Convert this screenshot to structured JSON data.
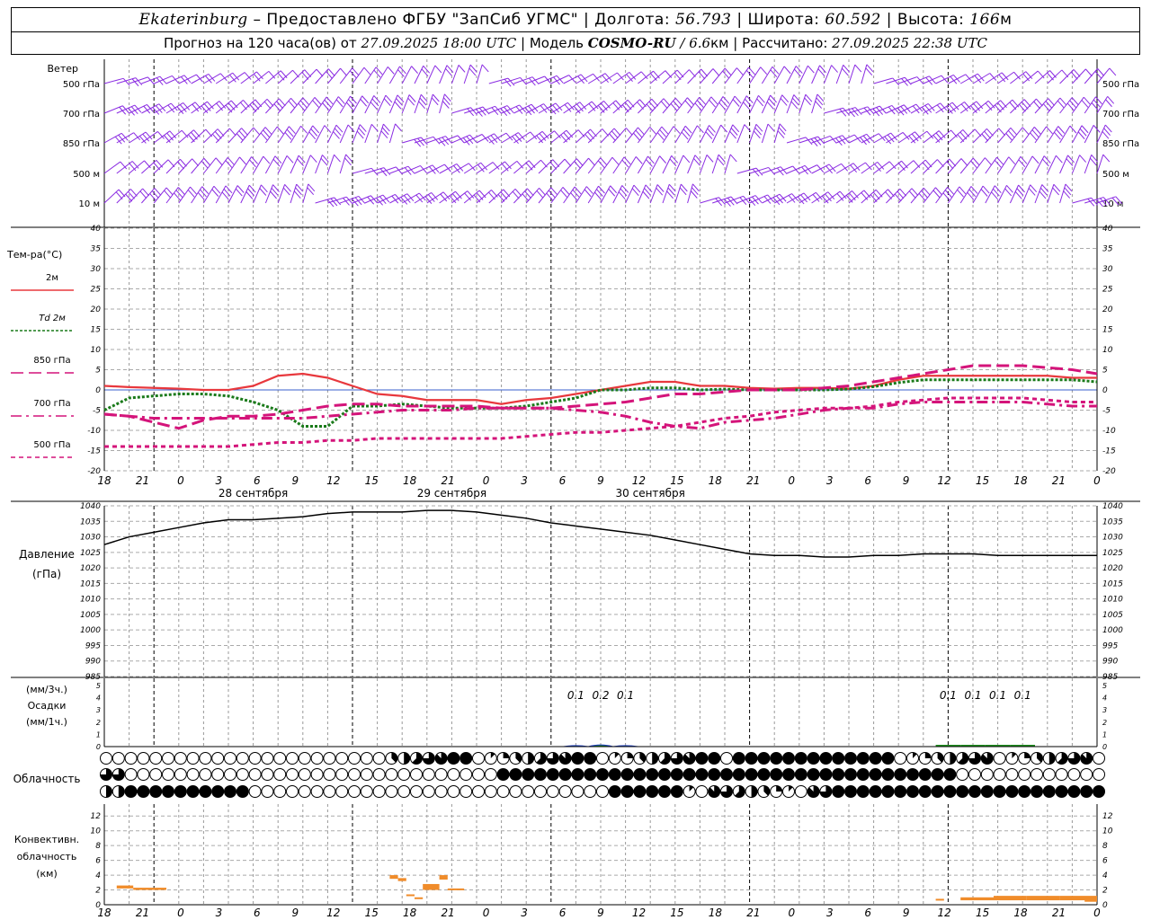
{
  "header": {
    "city": "Ekaterinburg",
    "provider": "– Предоставлено ФГБУ \"ЗапСиб УГМС\"",
    "lon_label": "Долгота:",
    "lon": "56.793",
    "lat_label": "Широта:",
    "lat": "60.592",
    "alt_label": "Высота:",
    "alt": "166",
    "alt_unit": "м",
    "forecast_label": "Прогноз на 120 часа(ов) от",
    "forecast_start": "27.09.2025 18:00 UTC",
    "model_label": "Модель",
    "model": "COSMO-RU",
    "resolution": "/ 6.6",
    "res_unit": "км",
    "computed_label": "Рассчитано:",
    "computed": "27.09.2025 22:38 UTC"
  },
  "time_axis": {
    "hour_labels": [
      "18",
      "21",
      "0",
      "3",
      "6",
      "9",
      "12",
      "15",
      "18",
      "21",
      "0",
      "3",
      "6",
      "9",
      "12",
      "15",
      "18",
      "21",
      "0",
      "3",
      "6",
      "9",
      "12",
      "15",
      "18",
      "21",
      "0"
    ],
    "day_labels": [
      "28 сентября",
      "29 сентября",
      "30 сентября"
    ]
  },
  "wind": {
    "title": "Ветер",
    "levels": [
      "500 гПа",
      "700 гПа",
      "850 гПа",
      "500 м",
      "10 м"
    ],
    "color": "#8a2be2"
  },
  "panels": {
    "temperature": {
      "title": "Тем-ра(°C)",
      "ticks": [
        "40",
        "35",
        "30",
        "25",
        "20",
        "15",
        "10",
        "5",
        "0",
        "-5",
        "-10",
        "-15",
        "-20"
      ]
    },
    "pressure": {
      "title": "Давление",
      "unit": "(гПа)",
      "ticks": [
        "1040",
        "1035",
        "1030",
        "1025",
        "1020",
        "1015",
        "1010",
        "1005",
        "1000",
        "995",
        "990",
        "985"
      ]
    },
    "precip": {
      "unit3": "(мм/3ч.)",
      "title": "Осадки",
      "unit1": "(мм/1ч.)",
      "ticks": [
        "5",
        "4",
        "3",
        "2",
        "1",
        "0"
      ]
    },
    "cloud": {
      "title": "Облачность"
    },
    "convective": {
      "title1": "Конвективн.",
      "title2": "облачность",
      "unit": "(км)",
      "ticks": [
        "12",
        "10",
        "8",
        "6",
        "4",
        "2",
        "0"
      ]
    }
  },
  "legend": [
    {
      "label": "2м",
      "color": "#e8383d",
      "style": "solid"
    },
    {
      "label": "Td  2м",
      "color": "#1a7a1a",
      "style": "dotted"
    },
    {
      "label": "850 гПа",
      "color": "#d4147a",
      "style": "longdash"
    },
    {
      "label": "700 гПа",
      "color": "#d4147a",
      "style": "dashdot"
    },
    {
      "label": "500 гПа",
      "color": "#d4147a",
      "style": "dash"
    }
  ],
  "chart_data": [
    {
      "type": "line",
      "title": "Тем-ра(°C)",
      "x_hours": [
        0,
        3,
        6,
        9,
        12,
        15,
        18,
        21,
        24,
        27,
        30,
        33,
        36,
        39,
        42,
        45,
        48,
        51,
        54,
        57,
        60,
        63,
        66,
        69,
        72,
        75,
        78,
        81,
        84,
        87,
        90,
        93,
        96,
        99,
        102,
        105,
        108,
        111,
        114,
        117,
        120
      ],
      "ylim": [
        -20,
        40
      ],
      "series": [
        {
          "name": "2м",
          "color": "#e8383d",
          "values": [
            1,
            0.7,
            0.5,
            0.3,
            0,
            0,
            1,
            3.5,
            4,
            3,
            1,
            -1,
            -1.5,
            -2.5,
            -2.5,
            -2.5,
            -3.5,
            -2.5,
            -2,
            -1,
            0,
            1,
            2,
            2,
            1,
            1,
            0.5,
            0.3,
            0.5,
            0.5,
            0.3,
            1,
            2.5,
            3.5,
            3.5,
            3.5,
            3.5,
            3.5,
            3.5,
            3,
            3
          ]
        },
        {
          "name": "Td  2м",
          "color": "#1a7a1a",
          "values": [
            -5,
            -2,
            -1.5,
            -1,
            -1,
            -1.5,
            -3,
            -5,
            -9,
            -9,
            -4,
            -4,
            -3.5,
            -4,
            -4.5,
            -4.5,
            -4.5,
            -4,
            -3,
            -2,
            0,
            0,
            0.5,
            0.5,
            0,
            0.2,
            0,
            0,
            0,
            0,
            0.2,
            0.8,
            1.8,
            2.5,
            2.5,
            2.5,
            2.5,
            2.5,
            2.5,
            2.5,
            2
          ]
        },
        {
          "name": "850 гПа",
          "color": "#d4147a",
          "values": [
            -6,
            -6.5,
            -8,
            -9.5,
            -7.5,
            -6.5,
            -6.5,
            -6,
            -5,
            -4,
            -3.5,
            -3.5,
            -4,
            -4,
            -4,
            -4,
            -4.5,
            -4.5,
            -4.5,
            -4,
            -3.5,
            -3,
            -2,
            -1,
            -1,
            -0.5,
            0,
            0,
            0,
            0.5,
            1,
            2,
            3,
            4,
            5,
            6,
            6,
            6,
            5.5,
            5,
            4
          ]
        },
        {
          "name": "700 гПа",
          "color": "#d4147a",
          "values": [
            -6,
            -6.5,
            -7,
            -7,
            -7,
            -7,
            -7,
            -7,
            -7,
            -6.5,
            -6,
            -5.5,
            -5,
            -5,
            -5,
            -4.5,
            -4.5,
            -4.5,
            -4.5,
            -5,
            -5.5,
            -6.5,
            -8,
            -9,
            -9.5,
            -8,
            -7.5,
            -7,
            -6,
            -5,
            -4.5,
            -4.5,
            -3.5,
            -3,
            -3,
            -3,
            -3,
            -3,
            -3.5,
            -4,
            -4
          ]
        },
        {
          "name": "500 гПа",
          "color": "#d4147a",
          "values": [
            -14,
            -14,
            -14,
            -14,
            -14,
            -14,
            -13.5,
            -13,
            -13,
            -12.5,
            -12.5,
            -12,
            -12,
            -12,
            -12,
            -12,
            -12,
            -11.5,
            -11,
            -10.5,
            -10.5,
            -10,
            -9.5,
            -9,
            -8,
            -7,
            -6.5,
            -5.5,
            -5,
            -4.5,
            -4.5,
            -4,
            -3,
            -2.5,
            -2,
            -2,
            -2,
            -2,
            -2.5,
            -3,
            -3
          ]
        }
      ]
    },
    {
      "type": "line",
      "title": "Давление",
      "x_hours": [
        0,
        3,
        6,
        9,
        12,
        15,
        18,
        21,
        24,
        27,
        30,
        33,
        36,
        39,
        42,
        45,
        48,
        51,
        54,
        57,
        60,
        63,
        66,
        69,
        72,
        75,
        78,
        81,
        84,
        87,
        90,
        93,
        96,
        99,
        102,
        105,
        108,
        111,
        114,
        117,
        120
      ],
      "ylim": [
        985,
        1040
      ],
      "series": [
        {
          "name": "",
          "color": "#000000",
          "values": [
            1027.5,
            1030,
            1031.5,
            1033,
            1034.5,
            1035.5,
            1035.5,
            1036,
            1036.5,
            1037.5,
            1038,
            1038,
            1038,
            1038.5,
            1038.5,
            1038,
            1037,
            1036,
            1034.5,
            1033.5,
            1032.5,
            1031.5,
            1030.5,
            1029,
            1027.5,
            1026,
            1024.5,
            1024,
            1024,
            1023.5,
            1023.5,
            1024,
            1024,
            1024.5,
            1024.5,
            1024.5,
            1024,
            1024,
            1024,
            1024,
            1024
          ]
        }
      ]
    },
    {
      "type": "bar",
      "title": "Осадки",
      "x_hours": [
        57,
        60,
        63
      ],
      "ylim": [
        0,
        5
      ],
      "series": [
        {
          "name": "",
          "values": [
            0.1,
            0.2,
            0.1
          ],
          "labels": [
            "0.1",
            "0.2",
            "0.1"
          ]
        }
      ],
      "extra_labels": [
        {
          "x_hour": 102,
          "text": "0.1"
        },
        {
          "x_hour": 105,
          "text": "0.1"
        },
        {
          "x_hour": 108,
          "text": "0.1"
        },
        {
          "x_hour": 111,
          "text": "0.1"
        }
      ]
    },
    {
      "type": "bar",
      "title": "Конвективн. облачность",
      "ylim": [
        0,
        13
      ],
      "segments": [
        {
          "x0": 1.5,
          "x1": 3.5,
          "base": 2.2,
          "top": 2.6
        },
        {
          "x0": 3.5,
          "x1": 7.5,
          "base": 2.0,
          "top": 2.3
        },
        {
          "x0": 34.5,
          "x1": 35.5,
          "base": 3.5,
          "top": 4.0
        },
        {
          "x0": 35.5,
          "x1": 36.5,
          "base": 3.2,
          "top": 3.6
        },
        {
          "x0": 36.5,
          "x1": 37.5,
          "base": 1.2,
          "top": 1.4
        },
        {
          "x0": 37.5,
          "x1": 38.5,
          "base": 0.8,
          "top": 1.0
        },
        {
          "x0": 38.5,
          "x1": 40.5,
          "base": 2.0,
          "top": 2.8
        },
        {
          "x0": 40.5,
          "x1": 41.5,
          "base": 3.4,
          "top": 4.0
        },
        {
          "x0": 41.5,
          "x1": 43.5,
          "base": 2.0,
          "top": 2.2
        },
        {
          "x0": 100.5,
          "x1": 101.5,
          "base": 0.6,
          "top": 0.8
        },
        {
          "x0": 103.5,
          "x1": 107.5,
          "base": 0.6,
          "top": 1.0
        },
        {
          "x0": 107.5,
          "x1": 111.5,
          "base": 0.6,
          "top": 1.2
        },
        {
          "x0": 111.5,
          "x1": 115.5,
          "base": 0.6,
          "top": 1.2
        },
        {
          "x0": 115.5,
          "x1": 120,
          "base": 0.6,
          "top": 1.2
        },
        {
          "x0": 118.5,
          "x1": 120,
          "base": 0.4,
          "top": 1.0
        }
      ]
    }
  ]
}
